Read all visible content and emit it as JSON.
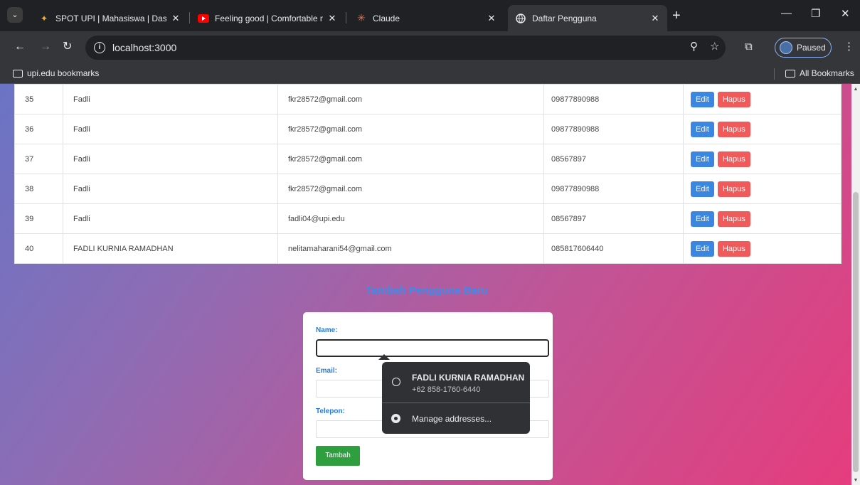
{
  "browser": {
    "tabs": [
      {
        "title": "SPOT UPI | Mahasiswa | Dashbo",
        "icon": "upi-logo-icon",
        "active": false
      },
      {
        "title": "Feeling good | Comfortable mu",
        "icon": "youtube-icon",
        "active": false
      },
      {
        "title": "Claude",
        "icon": "claude-icon",
        "active": false
      },
      {
        "title": "Daftar Pengguna",
        "icon": "globe-icon",
        "active": true
      }
    ],
    "url": "localhost:3000",
    "profile_label": "Paused",
    "bookmarks": {
      "folder": "upi.edu bookmarks",
      "all": "All Bookmarks"
    }
  },
  "users_table": {
    "rows": [
      {
        "id": "35",
        "name": "Fadli",
        "email": "fkr28572@gmail.com",
        "phone": "09877890988"
      },
      {
        "id": "36",
        "name": "Fadli",
        "email": "fkr28572@gmail.com",
        "phone": "09877890988"
      },
      {
        "id": "37",
        "name": "Fadli",
        "email": "fkr28572@gmail.com",
        "phone": "08567897"
      },
      {
        "id": "38",
        "name": "Fadli",
        "email": "fkr28572@gmail.com",
        "phone": "09877890988"
      },
      {
        "id": "39",
        "name": "Fadli",
        "email": "fadli04@upi.edu",
        "phone": "08567897"
      },
      {
        "id": "40",
        "name": "FADLI KURNIA RAMADHAN",
        "email": "nelitamaharani54@gmail.com",
        "phone": "085817606440"
      }
    ],
    "edit_label": "Edit",
    "delete_label": "Hapus"
  },
  "form": {
    "title": "Tambah Pengguna Baru",
    "name_label": "Name:",
    "email_label": "Email:",
    "phone_label": "Telepon:",
    "submit_label": "Tambah"
  },
  "autofill": {
    "name": "FADLI KURNIA RAMADHAN",
    "phone": "+62 858-1760-6440",
    "manage_label": "Manage addresses..."
  }
}
